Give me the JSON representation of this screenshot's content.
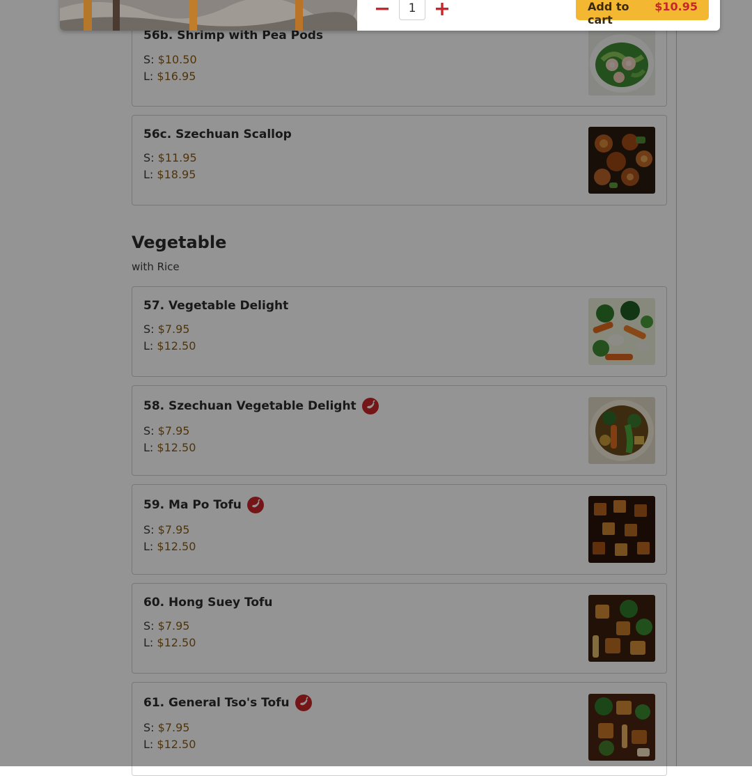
{
  "modal": {
    "quantity": "1",
    "add_label": "Add to cart",
    "add_price": "$10.95"
  },
  "section": {
    "title": "Vegetable",
    "subtitle": "with Rice"
  },
  "items": [
    {
      "name": "56b. Shrimp with Pea Pods",
      "s_label": "S:",
      "s_price": "$10.50",
      "l_label": "L:",
      "l_price": "$16.95",
      "spicy": false
    },
    {
      "name": "56c. Szechuan Scallop",
      "s_label": "S:",
      "s_price": "$11.95",
      "l_label": "L:",
      "l_price": "$18.95",
      "spicy": false
    },
    {
      "name": "57. Vegetable Delight",
      "s_label": "S:",
      "s_price": "$7.95",
      "l_label": "L:",
      "l_price": "$12.50",
      "spicy": false
    },
    {
      "name": "58. Szechuan Vegetable Delight",
      "s_label": "S:",
      "s_price": "$7.95",
      "l_label": "L:",
      "l_price": "$12.50",
      "spicy": true
    },
    {
      "name": "59. Ma Po Tofu",
      "s_label": "S:",
      "s_price": "$7.95",
      "l_label": "L:",
      "l_price": "$12.50",
      "spicy": true
    },
    {
      "name": "60. Hong Suey Tofu",
      "s_label": "S:",
      "s_price": "$7.95",
      "l_label": "L:",
      "l_price": "$12.50",
      "spicy": false
    },
    {
      "name": "61. General Tso's Tofu",
      "s_label": "S:",
      "s_price": "$7.95",
      "l_label": "L:",
      "l_price": "$12.50",
      "spicy": true
    }
  ],
  "icons": {
    "spicy": "chili-pepper-icon",
    "minus": "minus-icon",
    "plus": "plus-icon"
  },
  "colors": {
    "accent_red": "#c8262a",
    "cart_button": "#f4b731",
    "price_text": "#8a5a12"
  }
}
